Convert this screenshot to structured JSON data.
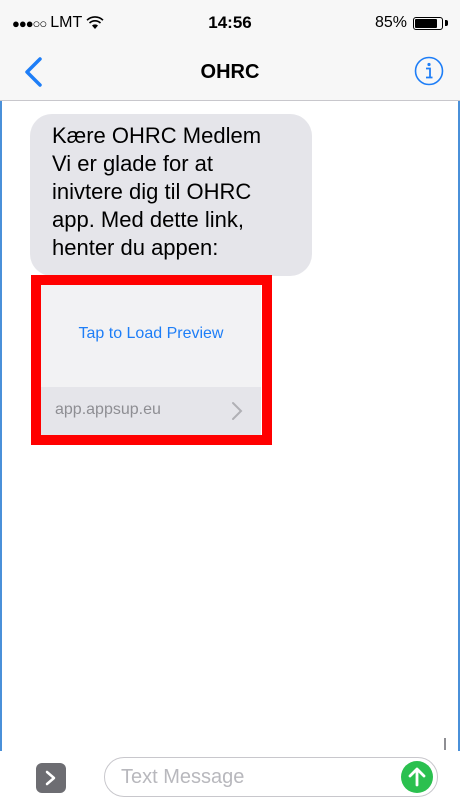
{
  "status_bar": {
    "signal": "●●●○○",
    "carrier": "LMT",
    "time": "14:56",
    "battery_text": "85%",
    "battery_level": 0.85
  },
  "nav": {
    "title": "OHRC",
    "back_icon": "chevron-left-icon",
    "info_icon": "info-icon"
  },
  "message": {
    "lines": [
      "Kære OHRC Medlem",
      "Vi er glade for at",
      "inivtere dig til OHRC",
      "app. Med dette link,",
      "henter du appen:"
    ]
  },
  "preview": {
    "tap_label": "Tap to Load Preview",
    "url": "app.appsup.eu",
    "highlight_color": "#ff0000"
  },
  "input_bar": {
    "placeholder": "Text Message",
    "value": "",
    "send_color": "#2bc04f"
  },
  "colors": {
    "accent": "#1e7ef7",
    "bubble": "#e5e5ea"
  }
}
